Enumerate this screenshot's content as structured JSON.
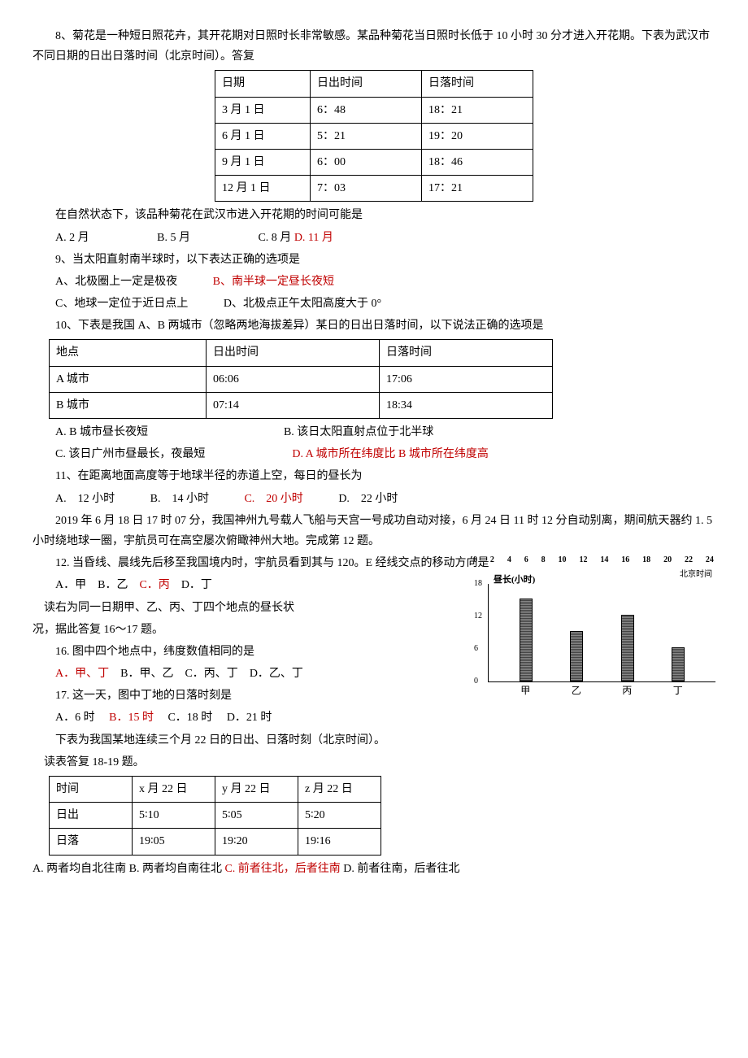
{
  "q8": {
    "stem": "8、菊花是一种短日照花卉，其开花期对日照时长非常敏感。某品种菊花当日照时长低于 10 小时 30 分才进入开花期。下表为武汉市不同日期的日出日落时间（北京时间）。答复",
    "table": {
      "h1": "日期",
      "h2": "日出时间",
      "h3": "日落时间",
      "r1c1": "3 月 1 日",
      "r1c2": "6：48",
      "r1c3": "18：21",
      "r2c1": "6 月 1 日",
      "r2c2": "5：21",
      "r2c3": "19：20",
      "r3c1": "9 月 1 日",
      "r3c2": "6：00",
      "r3c3": "18：46",
      "r4c1": "12 月 1 日",
      "r4c2": "7：03",
      "r4c3": "17：21"
    },
    "sub": "在自然状态下，该品种菊花在武汉市进入开花期的时间可能是",
    "optA": "A. 2 月",
    "optB": "B. 5 月",
    "optC": "C. 8 月 ",
    "optD": "D. 11 月"
  },
  "q9": {
    "stem": "9、当太阳直射南半球时，以下表达正确的选项是",
    "optA": "A、北极圈上一定是极夜",
    "optB": "B、南半球一定昼长夜短",
    "optC": "C、地球一定位于近日点上",
    "optD": "D、北极点正午太阳高度大于 0°"
  },
  "q10": {
    "stem": "10、下表是我国 A、B 两城市（忽略两地海拔差异）某日的日出日落时间，以下说法正确的选项是",
    "table": {
      "h1": "地点",
      "h2": "日出时间",
      "h3": "日落时间",
      "r1c1": "A 城市",
      "r1c2": "06:06",
      "r1c3": "17:06",
      "r2c1": "B 城市",
      "r2c2": "07:14",
      "r2c3": "18:34"
    },
    "optA": "A. B 城市昼长夜短",
    "optB": "B. 该日太阳直射点位于北半球",
    "optC": "C. 该日广州市昼最长，夜最短",
    "optD": "D. A 城市所在纬度比 B 城市所在纬度高"
  },
  "q11": {
    "stem": "11、在距离地面高度等于地球半径的赤道上空，每日的昼长为",
    "optA": "A.　12 小时",
    "optB": "B.　14 小时",
    "optC": "C.　20 小时",
    "optD": "D.　22 小时"
  },
  "passage12": "2019 年 6 月 18 日 17 时 07 分，我国神州九号载人飞船与天宫一号成功自动对接，6 月 24 日 11 时 12 分自动别离，期间航天器约 1. 5 小时绕地球一圈，宇航员可在高空屡次俯瞰神州大地。完成第 12 题。",
  "q12": {
    "stem": "12. 当昏线、晨线先后移至我国境内时，宇航员看到其与 120。E 经线交点的移动方向是",
    "optA": "A．甲",
    "optB": "B．乙",
    "optC": "C．丙",
    "optD": "D．丁"
  },
  "passage16": {
    "part1": "读右为同一日期甲、乙、丙、丁四个地点的昼长状",
    "part2": "况，据此答复 16～17 题。"
  },
  "q16": {
    "stem": "16. 图中四个地点中，纬度数值相同的是",
    "optA": "A．甲、丁",
    "optB": "B．甲、乙",
    "optC": "C．丙、丁",
    "optD": "D．乙、丁"
  },
  "q17": {
    "stem": "17. 这一天，图中丁地的日落时刻是",
    "optA": "A．6 时",
    "optB": "B．15 时",
    "optC": "C．18 时",
    "optD": "D．21 时"
  },
  "passage18": {
    "part1": "下表为我国某地连续三个月 22 日的日出、日落时刻（北京时间）。",
    "part2": "读表答复 18-19 题。"
  },
  "table18": {
    "h1": "时间",
    "h2": "x 月 22 日",
    "h3": "y 月 22 日",
    "h4": "z 月 22 日",
    "r1c1": "日出",
    "r1c2": "5∶10",
    "r1c3": "5∶05",
    "r1c4": "5∶20",
    "r2c1": "日落",
    "r2c2": "19∶05",
    "r2c3": "19∶20",
    "r2c4": "19∶16"
  },
  "q18line": {
    "garble": "A. 两者均自北往南 B. 两者均自南往北 ",
    "optC": "C. 前者往北，后者往南 ",
    "optD": "D. 前者往南，后者往北"
  },
  "chart_data": {
    "type": "bar",
    "title_top_ticks": [
      "0",
      "2",
      "4",
      "6",
      "8",
      "10",
      "12",
      "14",
      "16",
      "18",
      "20",
      "22",
      "24"
    ],
    "top_label": "北京时间",
    "ylabel": "昼长(小时)",
    "ylim": [
      0,
      18
    ],
    "yticks": [
      "0",
      "6",
      "12",
      "18"
    ],
    "categories": [
      "甲",
      "乙",
      "丙",
      "丁"
    ],
    "values": [
      15,
      9,
      12,
      6
    ]
  }
}
